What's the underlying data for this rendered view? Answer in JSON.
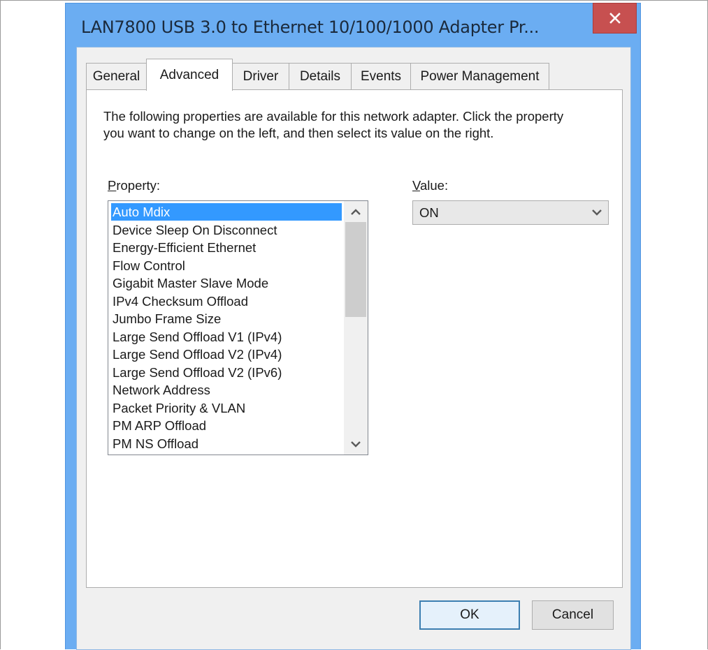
{
  "window": {
    "title": "LAN7800 USB 3.0 to Ethernet 10/100/1000 Adapter Pr...",
    "close_icon": "close-icon"
  },
  "tabs": [
    {
      "label": "General",
      "active": false
    },
    {
      "label": "Advanced",
      "active": true
    },
    {
      "label": "Driver",
      "active": false
    },
    {
      "label": "Details",
      "active": false
    },
    {
      "label": "Events",
      "active": false
    },
    {
      "label": "Power Management",
      "active": false
    }
  ],
  "advanced": {
    "description": "The following properties are available for this network adapter. Click the property you want to change on the left, and then select its value on the right.",
    "property_label_first": "P",
    "property_label_rest": "roperty:",
    "value_label_first": "V",
    "value_label_rest": "alue:",
    "properties": [
      "Auto Mdix",
      "Device Sleep On Disconnect",
      "Energy-Efficient Ethernet",
      "Flow Control",
      "Gigabit Master Slave Mode",
      "IPv4 Checksum Offload",
      "Jumbo Frame Size",
      "Large Send Offload V1 (IPv4)",
      "Large Send Offload V2 (IPv4)",
      "Large Send Offload V2 (IPv6)",
      "Network Address",
      "Packet Priority & VLAN",
      "PM ARP Offload",
      "PM NS Offload"
    ],
    "selected_property": "Auto Mdix",
    "value": "ON",
    "scroll_position": 0,
    "scroll_visible_fraction": 0.45
  },
  "buttons": {
    "ok": "OK",
    "cancel": "Cancel"
  },
  "colors": {
    "title_bar": "#6badf2",
    "close": "#c75050",
    "selection": "#3399ff"
  }
}
